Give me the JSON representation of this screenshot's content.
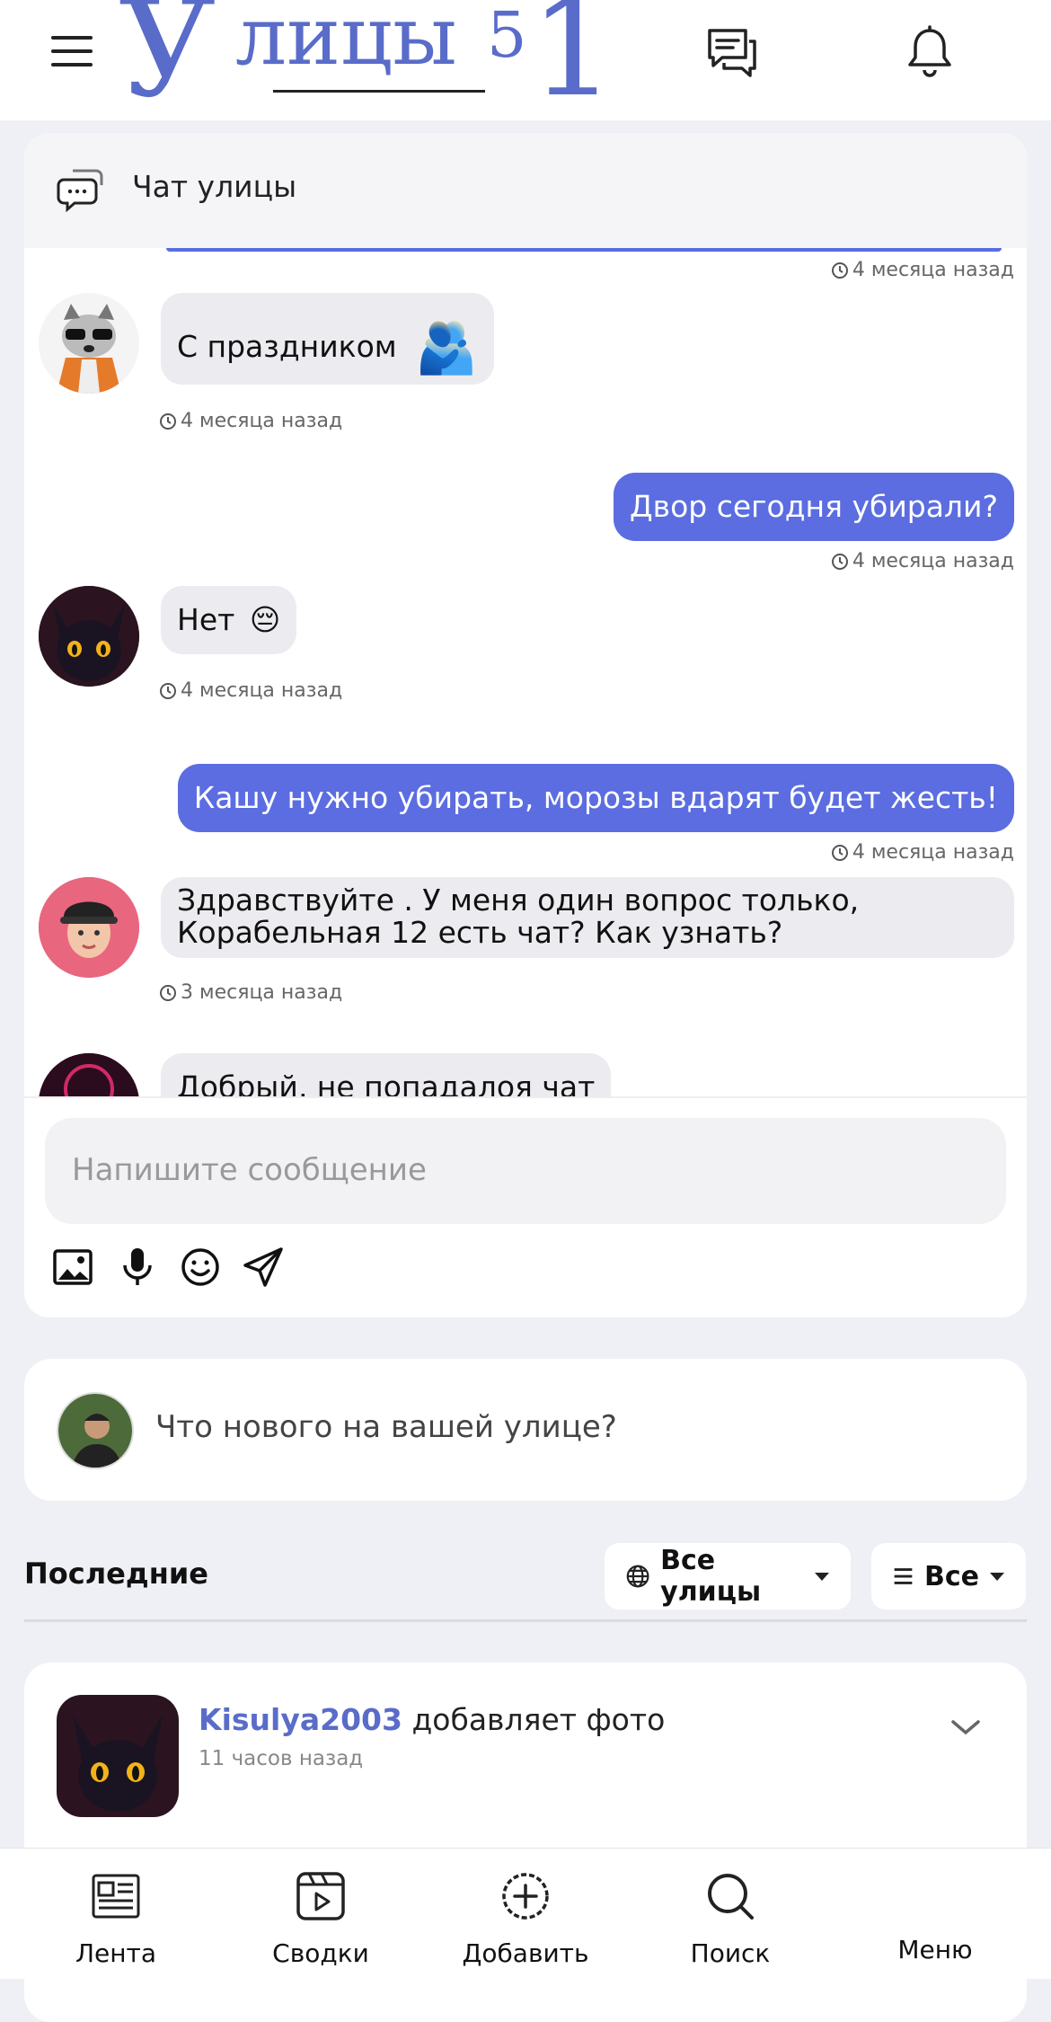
{
  "header": {
    "logo_letter": "У",
    "logo_text": "лицы",
    "logo_num_small": "5",
    "logo_num_big": "1"
  },
  "chat": {
    "title": "Чат улицы",
    "messages": [
      {
        "type": "time_only",
        "time": "4 месяца назад"
      },
      {
        "type": "in",
        "text": "С праздником",
        "emoji": "🫂",
        "time": "4 месяца назад",
        "avatar": "raccoon-avatar"
      },
      {
        "type": "out",
        "text": "Двор сегодня убирали?",
        "time": "4 месяца назад"
      },
      {
        "type": "in",
        "text": "Нет",
        "emoji": "😔",
        "time": "4 месяца назад",
        "avatar": "black-cat-avatar"
      },
      {
        "type": "out",
        "text": "Кашу нужно убирать, морозы вдарят будет жесть!",
        "time": "4 месяца назад"
      },
      {
        "type": "in",
        "text": "Здравствуйте . У меня один вопрос только, Корабельная 12 есть чат? Как узнать?",
        "time": "3 месяца назад",
        "avatar": "memoji-avatar"
      },
      {
        "type": "in",
        "text": "Добрый, не попадалоя чат",
        "avatar": "neon-avatar"
      }
    ],
    "input_placeholder": "Напишите сообщение"
  },
  "composer": {
    "placeholder": "Что нового на вашей улице?"
  },
  "feed": {
    "section_title": "Последние",
    "filter_streets": "Все улицы",
    "filter_all": "Все",
    "post": {
      "user": "Kisulya2003",
      "action": "добавляет фото",
      "time": "11 часов назад"
    }
  },
  "nav": {
    "items": [
      {
        "label": "Лента",
        "icon": "newspaper-icon"
      },
      {
        "label": "Сводки",
        "icon": "video-icon"
      },
      {
        "label": "Добавить",
        "icon": "add-circle-icon"
      },
      {
        "label": "Поиск",
        "icon": "search-icon"
      },
      {
        "label": "Меню",
        "icon": "profile-avatar"
      }
    ]
  },
  "colors": {
    "accent": "#5b6de0",
    "logo": "#5a6cc9",
    "background": "#eff0f5"
  }
}
